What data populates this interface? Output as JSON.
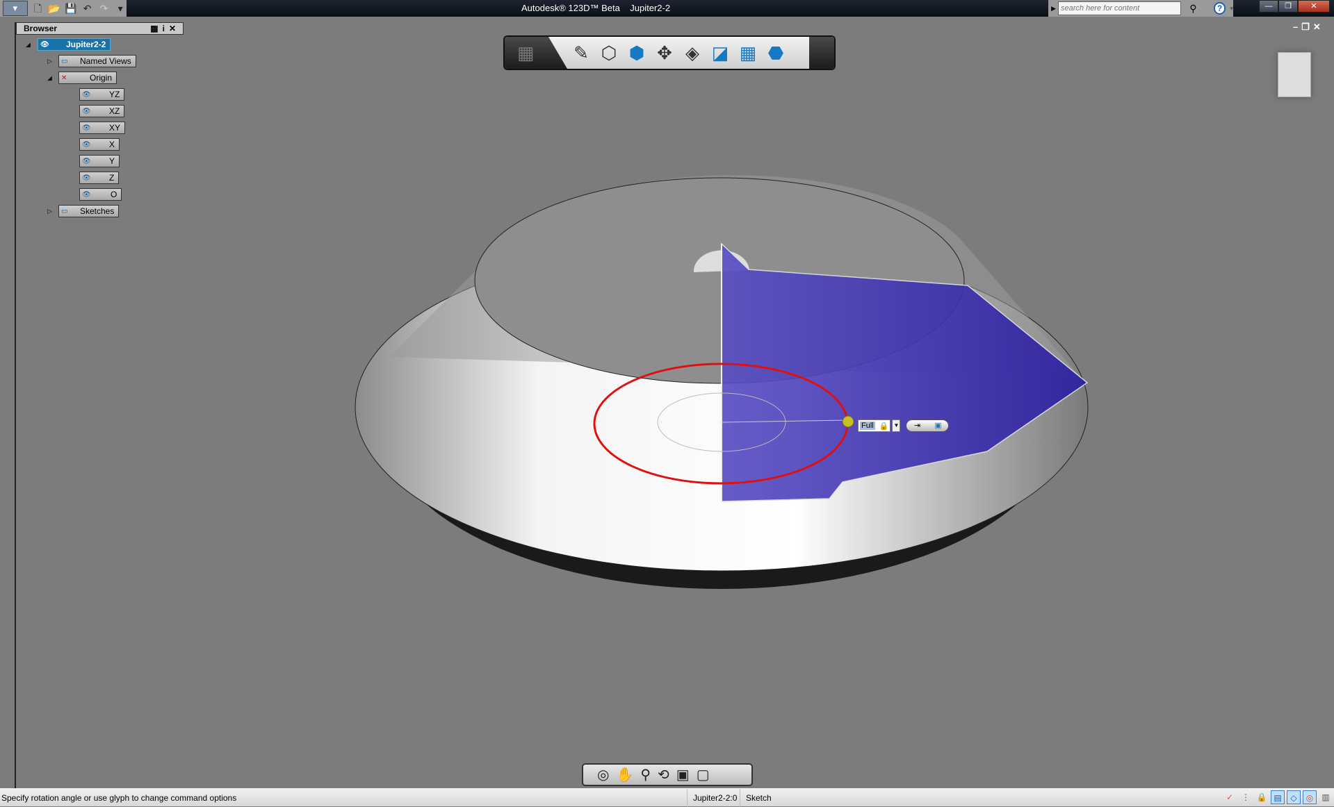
{
  "window": {
    "title": "Autodesk® 123D™ Beta    Jupiter2-2"
  },
  "search": {
    "placeholder": "search here for content"
  },
  "browser": {
    "title": "Browser",
    "root": "Jupiter2-2",
    "items": [
      {
        "label": "Named Views"
      },
      {
        "label": "Origin"
      },
      {
        "label": "YZ"
      },
      {
        "label": "XZ"
      },
      {
        "label": "XY"
      },
      {
        "label": "X"
      },
      {
        "label": "Y"
      },
      {
        "label": "Z"
      },
      {
        "label": "O"
      },
      {
        "label": "Sketches"
      }
    ]
  },
  "command": {
    "extent": "Full"
  },
  "status": {
    "prompt": "Specify rotation angle or use glyph to change command options",
    "document": "Jupiter2-2:0",
    "mode": "Sketch"
  },
  "colors": {
    "profile": "#3b2fa8",
    "axis_circle": "#e01010",
    "selection": "#1a73a8"
  }
}
